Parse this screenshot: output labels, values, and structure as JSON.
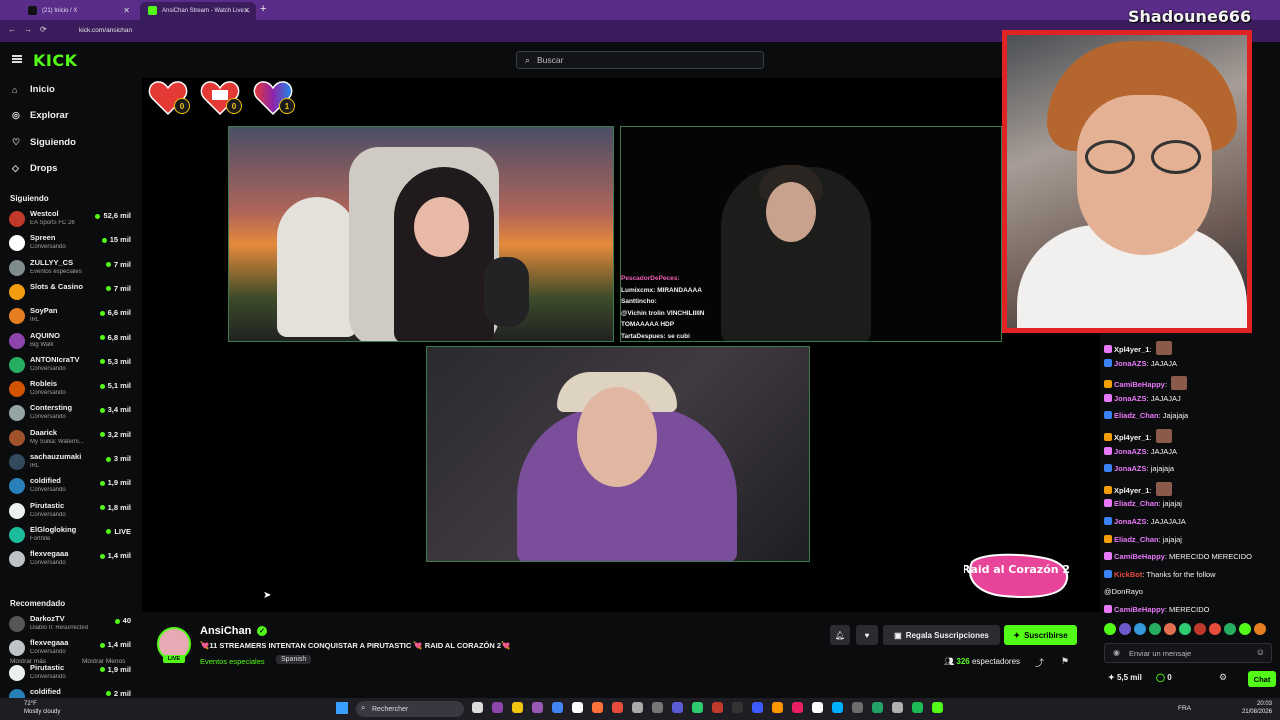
{
  "browser": {
    "tabs": [
      {
        "label": "(21) Inicio / X"
      },
      {
        "label": "AnsiChan Stream - Watch Live ..."
      }
    ],
    "url": "kick.com/ansichan"
  },
  "header": {
    "logo": "KICK",
    "search_placeholder": "Buscar"
  },
  "nav": [
    {
      "label": "Inicio",
      "icon": "home-icon"
    },
    {
      "label": "Explorar",
      "icon": "compass-icon"
    },
    {
      "label": "Siguiendo",
      "icon": "heart-icon"
    },
    {
      "label": "Drops",
      "icon": "drop-icon"
    }
  ],
  "following": {
    "title": "Siguiendo",
    "channels": [
      {
        "name": "Westcol",
        "sub": "EA Sports FC 26",
        "viewers": "52,6 mil",
        "color": "#c0392b"
      },
      {
        "name": "Spreen",
        "sub": "Conversando",
        "viewers": "15 mil",
        "color": "#ffffff"
      },
      {
        "name": "ZULLYY_CS",
        "sub": "Eventos especiales",
        "viewers": "7 mil",
        "color": "#7f8c8d"
      },
      {
        "name": "Slots & Casino",
        "sub": "",
        "viewers": "7 mil",
        "color": "#f39c12"
      },
      {
        "name": "SoyPan",
        "sub": "IRL",
        "viewers": "6,6 mil",
        "color": "#e67e22"
      },
      {
        "name": "AQUINO",
        "sub": "Big Walk",
        "viewers": "6,8 mil",
        "color": "#8e44ad"
      },
      {
        "name": "ANTONIcraTV",
        "sub": "Conversando",
        "viewers": "5,3 mil",
        "color": "#27ae60"
      },
      {
        "name": "Robleis",
        "sub": "Conversando",
        "viewers": "5,1 mil",
        "color": "#d35400"
      },
      {
        "name": "Contersting",
        "sub": "Conversando",
        "viewers": "3,4 mil",
        "color": "#95a5a6"
      },
      {
        "name": "Daarick",
        "sub": "My Suika: Waterm...",
        "viewers": "3,2 mil",
        "color": "#a0522d"
      },
      {
        "name": "sachauzumaki",
        "sub": "IRL",
        "viewers": "3 mil",
        "color": "#34495e"
      },
      {
        "name": "coldified",
        "sub": "Conversando",
        "viewers": "1,9 mil",
        "color": "#2980b9"
      },
      {
        "name": "Pirutastic",
        "sub": "Conversando",
        "viewers": "1,8 mil",
        "color": "#ecf0f1"
      },
      {
        "name": "ElGlogloking",
        "sub": "Fortnite",
        "viewers": "LIVE",
        "color": "#1abc9c"
      },
      {
        "name": "flexvegaaa",
        "sub": "Conversando",
        "viewers": "1,4 mil",
        "color": "#bdc3c7"
      }
    ],
    "show_more": "Mostrar más",
    "show_less": "Mostrar Menos"
  },
  "recommended": {
    "title": "Recomendado",
    "channels": [
      {
        "name": "DarkozTV",
        "sub": "Diablo II: Resurrected",
        "viewers": "40",
        "color": "#555555"
      },
      {
        "name": "flexvegaaa",
        "sub": "Conversando",
        "viewers": "1,4 mil",
        "color": "#bdc3c7"
      },
      {
        "name": "Pirutastic",
        "sub": "Conversando",
        "viewers": "1,9 mil",
        "color": "#ecf0f1"
      },
      {
        "name": "coldified",
        "sub": "",
        "viewers": "2 mil",
        "color": "#2980b9"
      }
    ]
  },
  "overlay": {
    "hearts": [
      {
        "count": "0",
        "color": "#e53935"
      },
      {
        "count": "0",
        "color": "#e53935"
      },
      {
        "count": "1",
        "color": "#e53935"
      }
    ],
    "chat_overlay": [
      "PescadorDePeces:",
      "Lumixcmx: MIRANDAAAA",
      "Santtincho:",
      "@Vichin trolin VINCHILIIIIN",
      "TOMAAAAA HDP",
      "TartaDespues: se cubi"
    ],
    "raid_text": "Raid al Corazón 2",
    "webcam_name": "Shadoune666"
  },
  "stream": {
    "channel": "AnsiChan",
    "live": "LIVE",
    "title": "💘11 STREAMERS INTENTAN CONQUISTAR A PIRUTASTIC 💘 RAID AL CORAZÓN 2💘",
    "category": "Eventos especiales",
    "language": "Spanish",
    "gift_label": "Regala Suscripciones",
    "subscribe_label": "Suscribirse",
    "viewers_count": "326",
    "viewers_label": "espectadores"
  },
  "chat": {
    "messages": [
      {
        "user": "Xpl4yer_1",
        "text": "",
        "color": "#f2f2f2",
        "emote": true
      },
      {
        "user": "JonaAZS",
        "text": "JAJAJA",
        "color": "#e879f9"
      },
      {
        "user": "CamiBeHappy",
        "text": "",
        "color": "#e879f9",
        "emote": true
      },
      {
        "user": "JonaAZS",
        "text": "JAJAJAJ",
        "color": "#e879f9"
      },
      {
        "user": "Eliadz_Chan",
        "text": "Jajajaja",
        "color": "#e879f9"
      },
      {
        "user": "Xpl4yer_1",
        "text": "",
        "color": "#f2f2f2",
        "emote": true
      },
      {
        "user": "JonaAZS",
        "text": "JAJAJA",
        "color": "#e879f9"
      },
      {
        "user": "JonaAZS",
        "text": "jajajaja",
        "color": "#e879f9"
      },
      {
        "user": "Xpl4yer_1",
        "text": "",
        "color": "#f2f2f2",
        "emote": true
      },
      {
        "user": "Eliadz_Chan",
        "text": "jajajaj",
        "color": "#e879f9"
      },
      {
        "user": "JonaAZS",
        "text": "JAJAJAJA",
        "color": "#e879f9"
      },
      {
        "user": "Eliadz_Chan",
        "text": "jajajaj",
        "color": "#e879f9"
      },
      {
        "user": "CamiBeHappy",
        "text": "MERECIDO MERECIDO",
        "color": "#e879f9"
      },
      {
        "user": "KickBot",
        "text": "Thanks for the follow",
        "color": "#e74c3c"
      },
      {
        "user": "",
        "text": "@DonRayo",
        "color": "#f2f2f2"
      },
      {
        "user": "CamiBeHappy",
        "text": "MERECIDO",
        "color": "#e879f9"
      }
    ],
    "input_placeholder": "Enviar un mensaje",
    "kicks": "5,5 mil",
    "points": "0",
    "chat_button": "Chat"
  },
  "taskbar": {
    "weather_temp": "72°F",
    "weather_desc": "Mostly cloudy",
    "search_label": "Rechercher",
    "lang": "FRA",
    "time": "20:03",
    "date": "21/08/2026"
  }
}
